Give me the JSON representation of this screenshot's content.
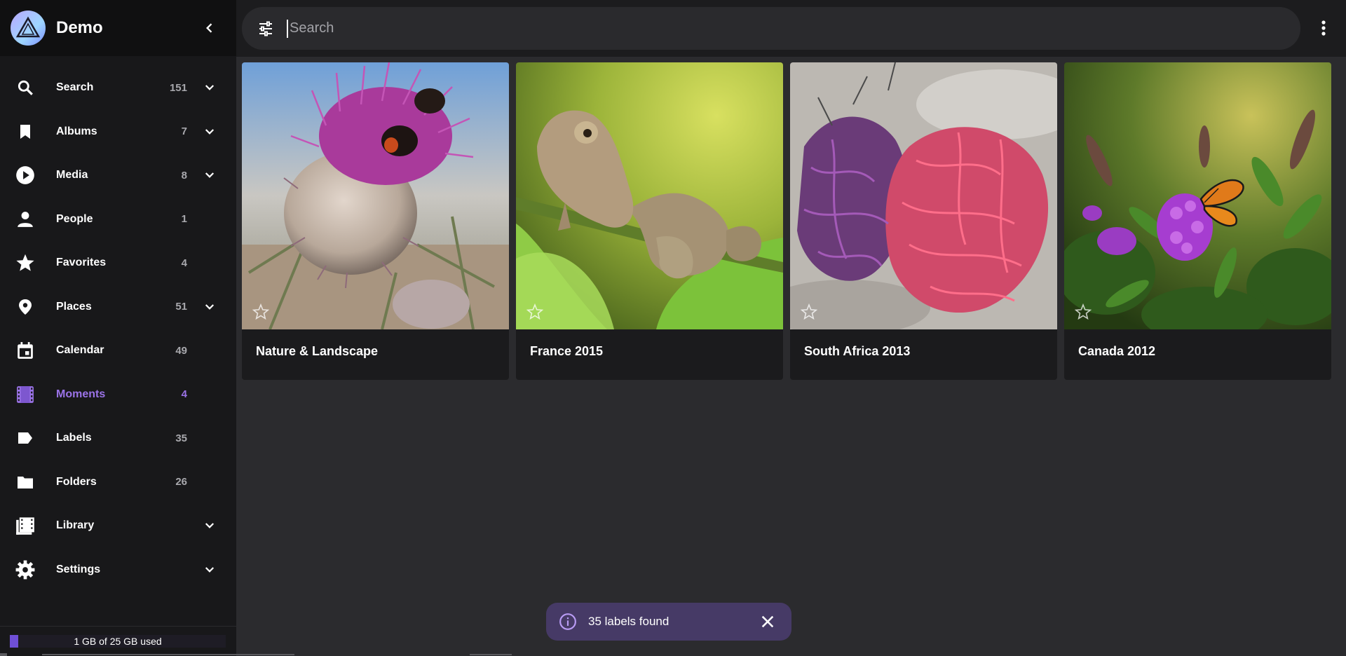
{
  "brand": {
    "title": "Demo"
  },
  "search": {
    "placeholder": "Search",
    "value": ""
  },
  "nav": {
    "items": [
      {
        "label": "Search",
        "count": "151"
      },
      {
        "label": "Albums",
        "count": "7"
      },
      {
        "label": "Media",
        "count": "8"
      },
      {
        "label": "People",
        "count": "1"
      },
      {
        "label": "Favorites",
        "count": "4"
      },
      {
        "label": "Places",
        "count": "51"
      },
      {
        "label": "Calendar",
        "count": "49"
      },
      {
        "label": "Moments",
        "count": "4"
      },
      {
        "label": "Labels",
        "count": "35"
      },
      {
        "label": "Folders",
        "count": "26"
      },
      {
        "label": "Library",
        "count": ""
      },
      {
        "label": "Settings",
        "count": ""
      }
    ],
    "active": "Moments"
  },
  "storage": {
    "text": "1 GB of 25 GB used",
    "fraction": 0.04
  },
  "moments": [
    {
      "title": "Nature & Landscape"
    },
    {
      "title": "France 2015"
    },
    {
      "title": "South Africa 2013"
    },
    {
      "title": "Canada 2012"
    }
  ],
  "snackbar": {
    "text": "35 labels found"
  },
  "colors": {
    "accent": "#9b73e8",
    "sidebar_bg": "#18181a",
    "content_bg": "#2b2b2e",
    "snackbar_bg": "#463a66"
  },
  "icons": {
    "nav": [
      "search-icon",
      "bookmark-icon",
      "play-circle-icon",
      "person-icon",
      "star-icon",
      "place-pin-icon",
      "calendar-icon",
      "film-icon",
      "label-icon",
      "folder-icon",
      "library-icon",
      "gear-icon"
    ]
  }
}
